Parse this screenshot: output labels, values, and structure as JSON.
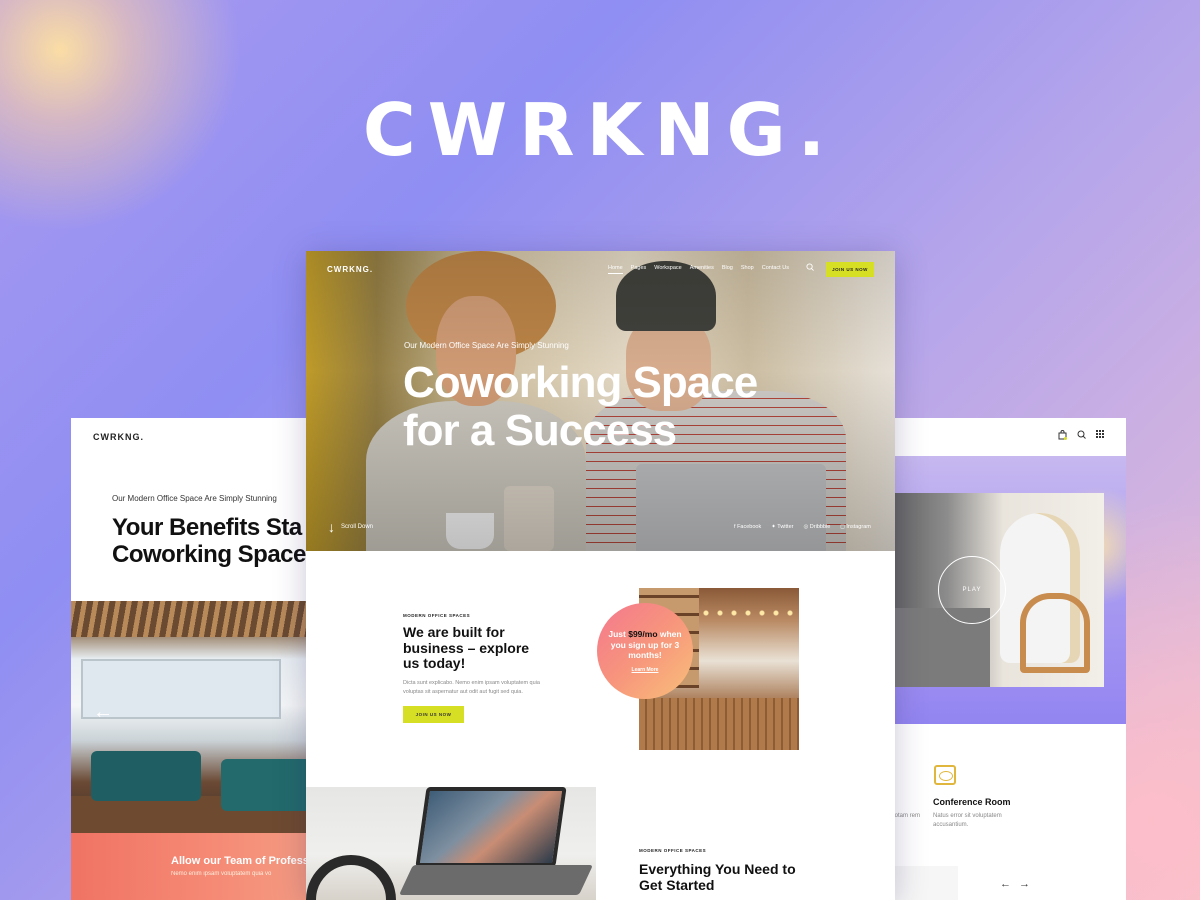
{
  "brand": {
    "title": "CWRKNG."
  },
  "left_page": {
    "logo": "CWRKNG.",
    "subtitle": "Our Modern Office Space Are Simply Stunning",
    "headline_line1": "Your Benefits Sta",
    "headline_line2": "Coworking Space",
    "arrow": "←",
    "banner_title": "Allow our Team of Profess",
    "banner_text": "Nemo enim ipsam voluptatem quia vo"
  },
  "center_page": {
    "nav": {
      "logo": "CWRKNG.",
      "menu": [
        "Home",
        "Pages",
        "Workspace",
        "Amenities",
        "Blog",
        "Shop",
        "Contact Us"
      ],
      "cta": "JOIN US NOW"
    },
    "hero": {
      "kicker": "Our Modern Office Space Are Simply Stunning",
      "headline_line1": "Coworking Space",
      "headline_line2": "for a Success",
      "scroll_label": "Scroll Down",
      "socials": [
        "Facebook",
        "Twitter",
        "Dribbble",
        "Instagram"
      ]
    },
    "section1": {
      "kicker": "MODERN OFFICE SPACES",
      "title": "We are built for business – explore us today!",
      "text": "Dicta sunt explicabo. Nemo enim ipsam voluptatem quia voluptas sit aspernatur aut odit aut fugit sed quia.",
      "button": "JOIN US NOW"
    },
    "promo": {
      "prefix": "Just ",
      "price": "$99/mo",
      "rest": " when you sign up for 3 months!",
      "link": "Learn More"
    },
    "section2": {
      "kicker": "MODERN OFFICE SPACES",
      "title": "Everything You Need to Get Started"
    }
  },
  "right_page": {
    "play_label": "PLAY",
    "conference_title": "Conference Room",
    "conference_text": "Natus error sit voluptatem accusantium.",
    "side_text": "totam rem",
    "arrow_prev": "←",
    "arrow_next": "→"
  },
  "colors": {
    "accent_yellow": "#d7df24",
    "banner_coral": "#f07363",
    "promo_gradient_start": "#f4788f",
    "promo_gradient_end": "#f9c07a"
  }
}
